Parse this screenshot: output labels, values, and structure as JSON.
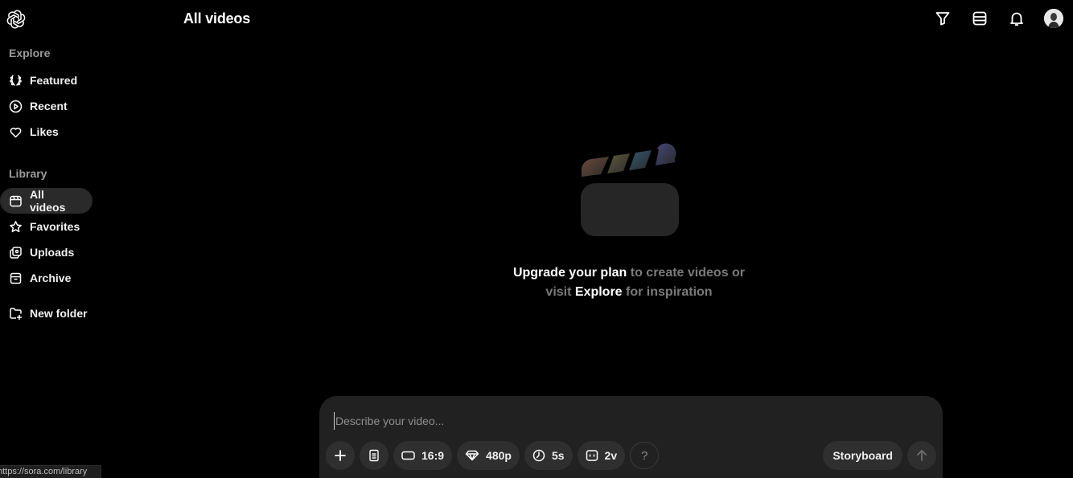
{
  "header": {
    "title": "All videos",
    "icons": [
      "filter-icon",
      "layout-icon",
      "bell-icon",
      "avatar"
    ]
  },
  "sidebar": {
    "explore_label": "Explore",
    "explore_items": [
      {
        "label": "Featured",
        "icon": "laurel-icon"
      },
      {
        "label": "Recent",
        "icon": "play-circle-icon"
      },
      {
        "label": "Likes",
        "icon": "heart-icon"
      }
    ],
    "library_label": "Library",
    "library_items": [
      {
        "label": "All videos",
        "icon": "calendar-icon",
        "active": true
      },
      {
        "label": "Favorites",
        "icon": "star-icon"
      },
      {
        "label": "Uploads",
        "icon": "uploads-icon"
      },
      {
        "label": "Archive",
        "icon": "archive-icon"
      }
    ],
    "new_folder_label": "New folder"
  },
  "empty_state": {
    "upgrade": "Upgrade your plan",
    "mid1": " to create videos or",
    "visit": "visit ",
    "explore": "Explore",
    "tail": " for inspiration"
  },
  "composer": {
    "placeholder": "Describe your video...",
    "aspect_ratio": "16:9",
    "resolution": "480p",
    "duration": "5s",
    "variations": "2v",
    "help": "?",
    "storyboard": "Storyboard"
  },
  "status_bar": {
    "url": "https://sora.com/library"
  },
  "colors": {
    "background": "#000000",
    "composer": "#212121",
    "pill": "#2f2f2f",
    "active_nav": "#2a2a2a",
    "muted_text": "#7a7a7a"
  }
}
